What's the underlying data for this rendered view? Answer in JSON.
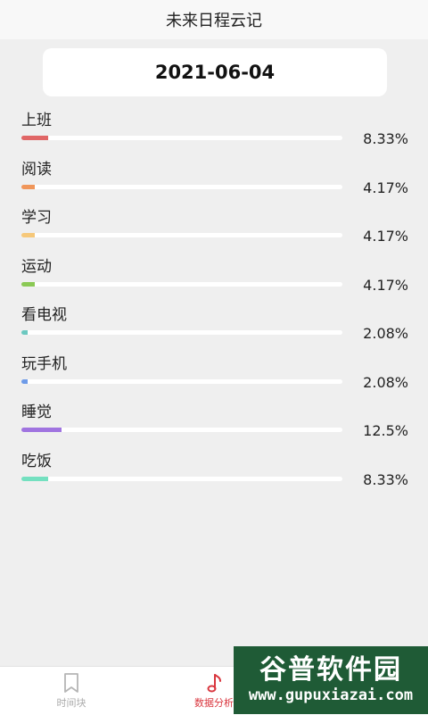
{
  "header": {
    "title": "未来日程云记"
  },
  "date": "2021-06-04",
  "stats": [
    {
      "label": "上班",
      "percent": "8.33%",
      "fraction": 0.0833,
      "color": "#e06666"
    },
    {
      "label": "阅读",
      "percent": "4.17%",
      "fraction": 0.0417,
      "color": "#f0965a"
    },
    {
      "label": "学习",
      "percent": "4.17%",
      "fraction": 0.0417,
      "color": "#f6c87a"
    },
    {
      "label": "运动",
      "percent": "4.17%",
      "fraction": 0.0417,
      "color": "#8bc955"
    },
    {
      "label": "看电视",
      "percent": "2.08%",
      "fraction": 0.0208,
      "color": "#6cc8c0"
    },
    {
      "label": "玩手机",
      "percent": "2.08%",
      "fraction": 0.0208,
      "color": "#6e9be8"
    },
    {
      "label": "睡觉",
      "percent": "12.5%",
      "fraction": 0.125,
      "color": "#a074e0"
    },
    {
      "label": "吃饭",
      "percent": "8.33%",
      "fraction": 0.0833,
      "color": "#74e0c0"
    }
  ],
  "tabbar": {
    "items": [
      {
        "label": "时间块",
        "icon": "bookmark-icon",
        "active": false
      },
      {
        "label": "数据分析",
        "icon": "music-note-icon",
        "active": true
      }
    ]
  },
  "watermark": {
    "top": "谷普软件园",
    "bottom": "www.gupuxiazai.com"
  }
}
